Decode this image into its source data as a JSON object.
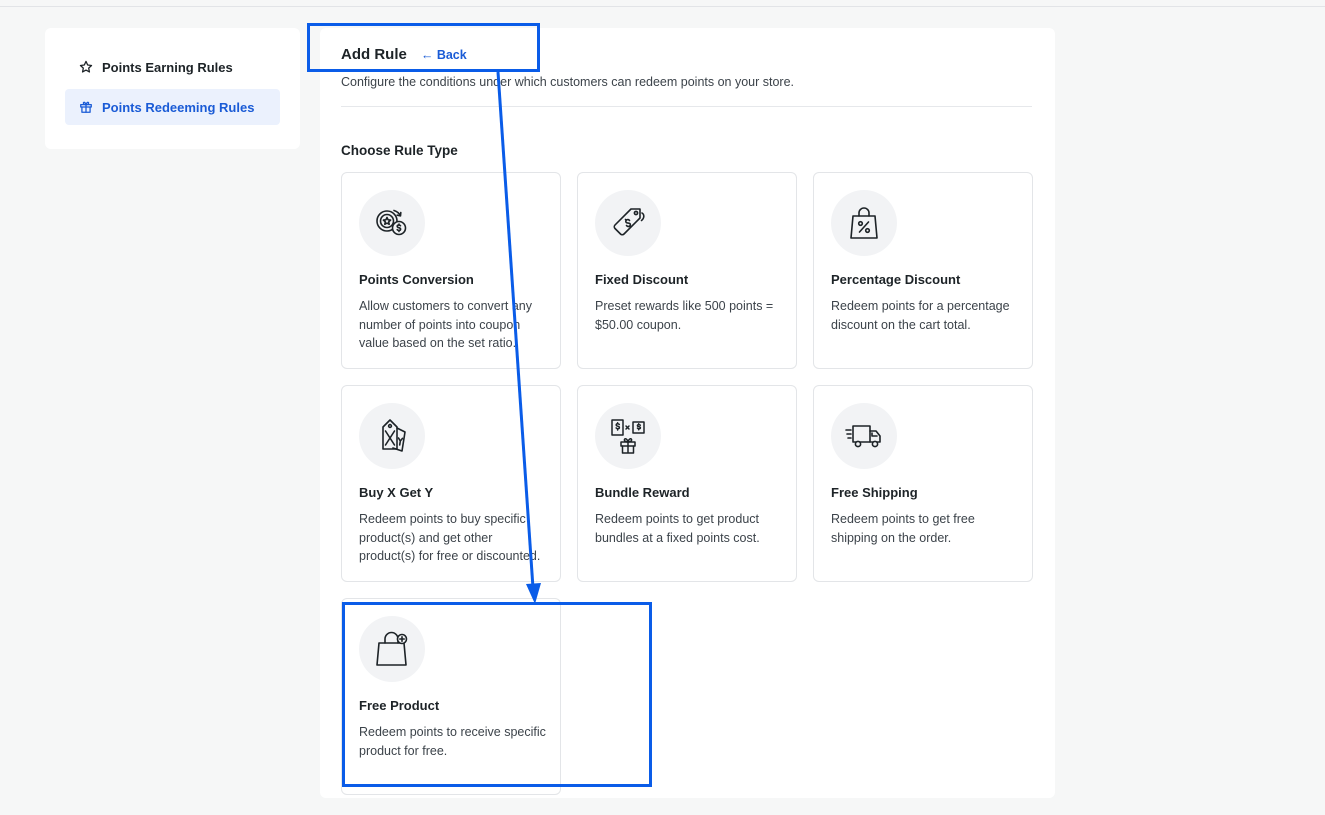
{
  "colors": {
    "accent": "#1a5bd6",
    "annotation": "#0a5ce8",
    "active_bg": "#ebf1fd"
  },
  "sidebar": {
    "items": [
      {
        "label": "Points Earning Rules",
        "icon": "star-icon",
        "active": false
      },
      {
        "label": "Points Redeeming Rules",
        "icon": "gift-icon",
        "active": true
      }
    ]
  },
  "header": {
    "title": "Add Rule",
    "back_label": "← Back",
    "subtitle": "Configure the conditions under which customers can redeem points on your store."
  },
  "section": {
    "title": "Choose Rule Type"
  },
  "cards": [
    {
      "title": "Points Conversion",
      "description": "Allow customers to convert any number of points into coupon value based on the set ratio.",
      "icon": "points-conversion-icon"
    },
    {
      "title": "Fixed Discount",
      "description": "Preset rewards like 500 points = $50.00 coupon.",
      "icon": "price-tag-icon"
    },
    {
      "title": "Percentage Discount",
      "description": "Redeem points for a percentage discount on the cart total.",
      "icon": "percentage-bag-icon"
    },
    {
      "title": "Buy X Get Y",
      "description": "Redeem points to buy specific product(s) and get other product(s) for free or discounted.",
      "icon": "xy-tags-icon"
    },
    {
      "title": "Bundle Reward",
      "description": "Redeem points to get product bundles at a fixed points cost.",
      "icon": "bundle-icon"
    },
    {
      "title": "Free Shipping",
      "description": "Redeem points to get free shipping on the order.",
      "icon": "delivery-truck-icon"
    },
    {
      "title": "Free Product",
      "description": "Redeem points to receive specific product for free.",
      "icon": "shopping-bag-plus-icon"
    }
  ]
}
